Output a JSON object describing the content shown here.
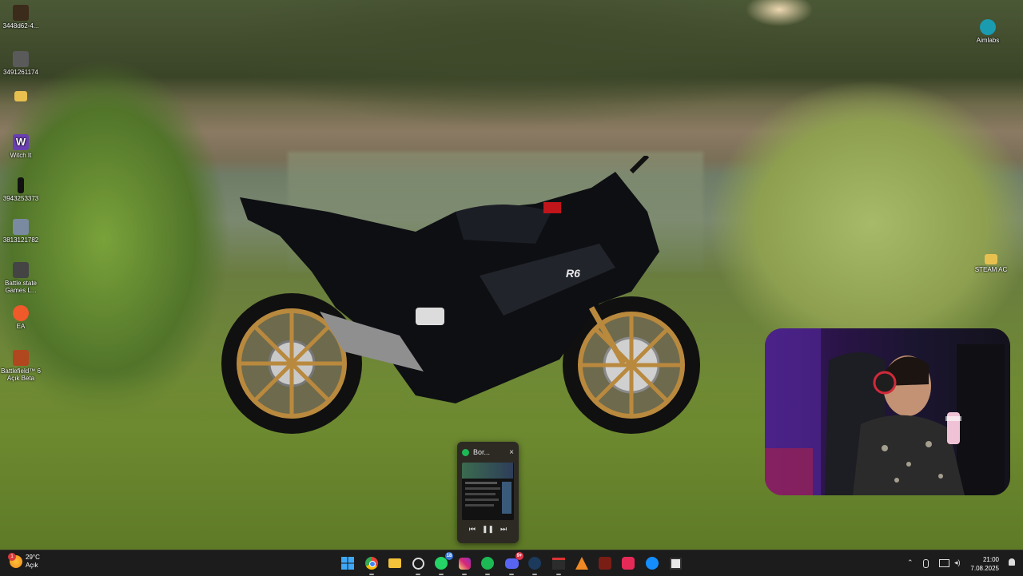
{
  "desktop": {
    "icons_left": [
      {
        "label": "3448d62-4...",
        "icon": "game-shortcut-icon"
      },
      {
        "label": "3491261174",
        "icon": "game-shortcut-icon"
      },
      {
        "label": "",
        "icon": "folder-icon"
      },
      {
        "label": "Witch It",
        "icon": "witch-it-icon"
      },
      {
        "label": "3943253373",
        "icon": "game-shortcut-icon"
      },
      {
        "label": "3813121782",
        "icon": "game-shortcut-icon"
      },
      {
        "label": "Battle.state Games L...",
        "icon": "battlestate-icon"
      },
      {
        "label": "EA",
        "icon": "ea-icon"
      },
      {
        "label": "Battlefield™ 6 Açık Beta",
        "icon": "battlefield-icon"
      }
    ],
    "icons_right": [
      {
        "label": "Aimlabs",
        "icon": "aimlabs-icon"
      },
      {
        "label": "STEAM AC",
        "icon": "folder-icon"
      }
    ],
    "wallpaper_badge": "R6"
  },
  "spotify_preview": {
    "title": "Bor...",
    "close": "×",
    "controls": {
      "prev": "⏮",
      "pause": "❚❚",
      "next": "⏭"
    }
  },
  "taskbar": {
    "weather": {
      "temp": "29°C",
      "condition": "Açık",
      "badge": "1"
    },
    "apps": [
      {
        "name": "Start",
        "icon": "windows-start-icon"
      },
      {
        "name": "Chrome",
        "icon": "chrome-icon"
      },
      {
        "name": "File Explorer",
        "icon": "folder-icon"
      },
      {
        "name": "GitHub",
        "icon": "github-icon"
      },
      {
        "name": "WhatsApp",
        "icon": "whatsapp-icon",
        "badge": "18"
      },
      {
        "name": "Instagram",
        "icon": "instagram-icon"
      },
      {
        "name": "Spotify",
        "icon": "spotify-icon"
      },
      {
        "name": "Discord",
        "icon": "discord-icon",
        "badge": "9+"
      },
      {
        "name": "Steam",
        "icon": "steam-icon"
      },
      {
        "name": "Stream app",
        "icon": "stream-app-icon"
      },
      {
        "name": "Artifact",
        "icon": "artifact-icon"
      },
      {
        "name": "Game",
        "icon": "game-icon"
      },
      {
        "name": "TikTok",
        "icon": "tiktok-icon"
      },
      {
        "name": "Battle.net",
        "icon": "battlenet-icon"
      },
      {
        "name": "Minecraft",
        "icon": "minecraft-icon"
      }
    ],
    "tray": {
      "chevron": "⌃",
      "mic": "🎙",
      "time": "21:00",
      "date": "7.08.2025"
    }
  },
  "colors": {
    "taskbar": "#1c1c1c",
    "spotify_green": "#1db954",
    "discord": "#5865f2"
  }
}
